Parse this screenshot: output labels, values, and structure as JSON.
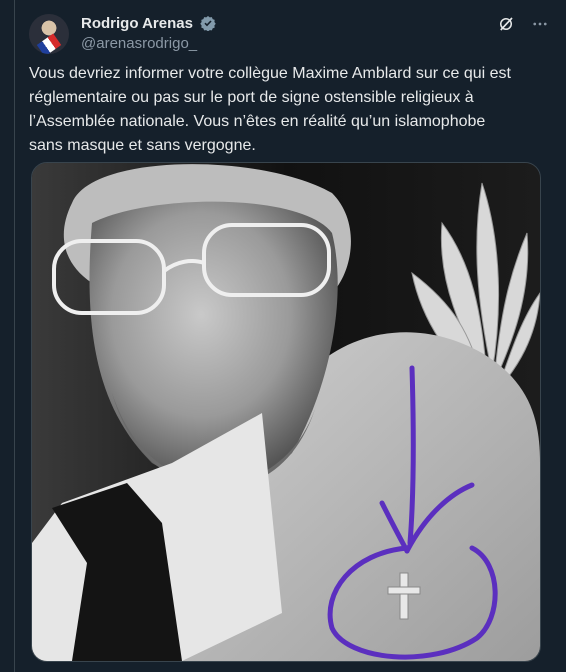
{
  "tweet": {
    "author": {
      "display_name": "Rodrigo Arenas",
      "handle": "@arenasrodrigo_",
      "verified": true
    },
    "header_actions": [
      {
        "name": "grok-icon"
      },
      {
        "name": "more-icon"
      }
    ],
    "text": "Vous devriez informer votre collègue Maxime Amblard sur ce qui est réglementaire ou pas sur le port de signe ostensible religieux à l’Assemblée nationale. Vous n’êtes en réalité qu’un islamophobe sans masque et sans vergogne.",
    "media": {
      "kind": "photo",
      "annotation_color": "#5b2fbf"
    }
  },
  "colors": {
    "background": "#15202b",
    "text": "#e7e9ea",
    "secondary_text": "#8b98a5",
    "verified": "#829aab",
    "border": "#38444d"
  }
}
